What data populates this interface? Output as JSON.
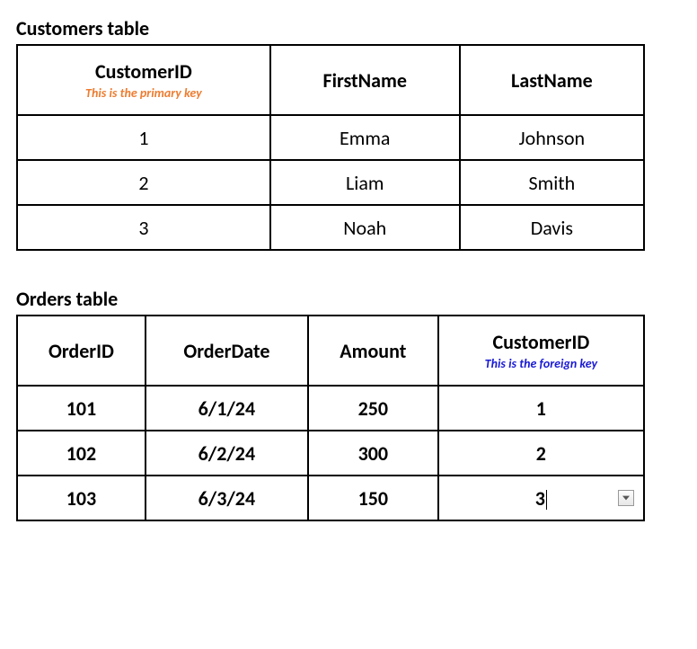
{
  "customers": {
    "title": "Customers table",
    "headers": {
      "customer_id": "CustomerID",
      "customer_id_sub": "This is the primary key",
      "first_name": "FirstName",
      "last_name": "LastName"
    },
    "rows": [
      {
        "id": "1",
        "first": "Emma",
        "last": "Johnson"
      },
      {
        "id": "2",
        "first": "Liam",
        "last": "Smith"
      },
      {
        "id": "3",
        "first": "Noah",
        "last": "Davis"
      }
    ]
  },
  "orders": {
    "title": "Orders table",
    "headers": {
      "order_id": "OrderID",
      "order_date": "OrderDate",
      "amount": "Amount",
      "customer_id": "CustomerID",
      "customer_id_sub": "This is the foreign key"
    },
    "rows": [
      {
        "id": "101",
        "date": "6/1/24",
        "amount": "250",
        "customer_id": "1"
      },
      {
        "id": "102",
        "date": "6/2/24",
        "amount": "300",
        "customer_id": "2"
      },
      {
        "id": "103",
        "date": "6/3/24",
        "amount": "150",
        "customer_id": "3"
      }
    ]
  }
}
